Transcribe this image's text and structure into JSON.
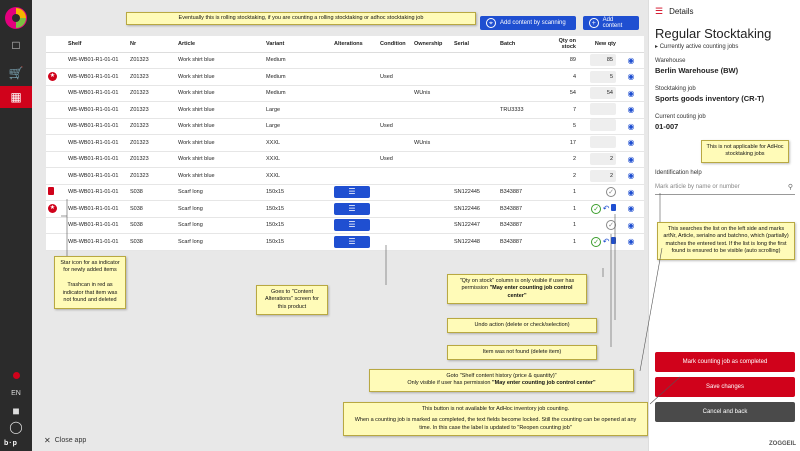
{
  "nav": {
    "language": "EN"
  },
  "toolbar": {
    "add_scan_label": "Add content by scanning",
    "add_content_label": "Add content"
  },
  "table": {
    "headers": [
      "",
      "Shelf",
      "Nr",
      "Article",
      "Variant",
      "Alterations",
      "Condition",
      "Ownership",
      "Serial",
      "Batch",
      "Qty on stock",
      "New qty",
      ""
    ],
    "rows": [
      {
        "flag": "",
        "shelf": "WB-WB01-R1-01-01",
        "nr": "Z01323",
        "article": "Work shirt blue",
        "variant": "Medium",
        "alterations": false,
        "condition": "",
        "ownership": "",
        "serial": "",
        "batch": "",
        "qty": "89",
        "new_qty": "85",
        "status": ""
      },
      {
        "flag": "star",
        "shelf": "WB-WB01-R1-01-01",
        "nr": "Z01323",
        "article": "Work shirt blue",
        "variant": "Medium",
        "alterations": false,
        "condition": "Used",
        "ownership": "",
        "serial": "",
        "batch": "",
        "qty": "4",
        "new_qty": "5",
        "status": ""
      },
      {
        "flag": "",
        "shelf": "WB-WB01-R1-01-01",
        "nr": "Z01323",
        "article": "Work shirt blue",
        "variant": "Medium",
        "alterations": false,
        "condition": "",
        "ownership": "WUnis",
        "serial": "",
        "batch": "",
        "qty": "54",
        "new_qty": "54",
        "status": ""
      },
      {
        "flag": "",
        "shelf": "WB-WB01-R1-01-01",
        "nr": "Z01323",
        "article": "Work shirt blue",
        "variant": "Large",
        "alterations": false,
        "condition": "",
        "ownership": "",
        "serial": "",
        "batch": "TRU3333",
        "qty": "7",
        "new_qty": "",
        "status": ""
      },
      {
        "flag": "",
        "shelf": "WB-WB01-R1-01-01",
        "nr": "Z01323",
        "article": "Work shirt blue",
        "variant": "Large",
        "alterations": false,
        "condition": "Used",
        "ownership": "",
        "serial": "",
        "batch": "",
        "qty": "5",
        "new_qty": "",
        "status": ""
      },
      {
        "flag": "",
        "shelf": "WB-WB01-R1-01-01",
        "nr": "Z01323",
        "article": "Work shirt blue",
        "variant": "XXXL",
        "alterations": false,
        "condition": "",
        "ownership": "WUnis",
        "serial": "",
        "batch": "",
        "qty": "17",
        "new_qty": "",
        "status": ""
      },
      {
        "flag": "",
        "shelf": "WB-WB01-R1-01-01",
        "nr": "Z01323",
        "article": "Work shirt blue",
        "variant": "XXXL",
        "alterations": false,
        "condition": "Used",
        "ownership": "",
        "serial": "",
        "batch": "",
        "qty": "2",
        "new_qty": "2",
        "status": ""
      },
      {
        "flag": "",
        "shelf": "WB-WB01-R1-01-01",
        "nr": "Z01323",
        "article": "Work shirt blue",
        "variant": "XXXL",
        "alterations": false,
        "condition": "",
        "ownership": "",
        "serial": "",
        "batch": "",
        "qty": "2",
        "new_qty": "2",
        "status": ""
      },
      {
        "flag": "trash",
        "shelf": "WB-WB01-R1-01-01",
        "nr": "S038",
        "article": "Scarf long",
        "variant": "150x15",
        "alterations": true,
        "condition": "",
        "ownership": "",
        "serial": "SN122445",
        "batch": "B343887",
        "qty": "1",
        "new_qty": "",
        "status": "check-grey"
      },
      {
        "flag": "star",
        "shelf": "WB-WB01-R1-01-01",
        "nr": "S038",
        "article": "Scarf long",
        "variant": "150x15",
        "alterations": true,
        "condition": "",
        "ownership": "",
        "serial": "SN122446",
        "batch": "B343887",
        "qty": "1",
        "new_qty": "",
        "status": "check-green"
      },
      {
        "flag": "",
        "shelf": "WB-WB01-R1-01-01",
        "nr": "S038",
        "article": "Scarf long",
        "variant": "150x15",
        "alterations": true,
        "condition": "",
        "ownership": "",
        "serial": "SN122447",
        "batch": "B343887",
        "qty": "1",
        "new_qty": "",
        "status": "check-grey"
      },
      {
        "flag": "",
        "shelf": "WB-WB01-R1-01-01",
        "nr": "S038",
        "article": "Scarf long",
        "variant": "150x15",
        "alterations": true,
        "condition": "",
        "ownership": "",
        "serial": "SN122448",
        "batch": "B343887",
        "qty": "1",
        "new_qty": "",
        "status": "check-green"
      }
    ]
  },
  "notes": {
    "top": "Eventually this is rolling stocktaking, if you are counting a rolling stocktaking or adhoc stocktaking job",
    "star": "Star icon for as indicator for newly added items\n\nTrashcan in red as indicator that item was not found and deleted",
    "alterations": "Goes to \"Content Alterations\" screen for this product",
    "qty_on_stock_pre": "\"Qty on stock\" column is only visible if user has permission ",
    "qty_on_stock_bold": "\"May enter counting job control center\"",
    "undo": "Undo action (delete or check/selection)",
    "not_found": "Item was not found (delete item)",
    "history_line1": "Goto \"Shelf content history (price & quantity)\"",
    "history_line2_pre": "Only visible if user has permission ",
    "history_line2_bold": "\"May enter counting job control center\"",
    "adhoc_line1": "This button is not available for AdHoc inventory job counting.",
    "adhoc_line2": "When a counting job is marked as completed, the text fields become locked. Still the counting can be opened at any time. In this case the label is updated to \"Reopen counting job\"",
    "not_applicable": "This is not applicable for AdHoc stocktaking jobs",
    "search_help": "This searches the list on the left side and marks artNr, Article, serialno and batchno, which (partially) matches the entered text. If the list is long the first found is ensured to be visible (auto scrolling)"
  },
  "close_app": "Close app",
  "details": {
    "header": "Details",
    "title": "Regular Stocktaking",
    "subtitle": "Currently active counting jobs",
    "warehouse_label": "Warehouse",
    "warehouse_value": "Berlin Warehouse (BW)",
    "job_label": "Stocktaking job",
    "job_value": "Sports goods inventory (CR-T)",
    "period_label": "Current couting job",
    "period_value": "01-007",
    "id_help_label": "Identification help",
    "search_placeholder": "Mark article by name or number",
    "complete_label": "Mark counting job as completed",
    "save_label": "Save changes",
    "cancel_label": "Cancel and back",
    "brand": "ZOGGEIL"
  },
  "colors": {
    "accent_red": "#d0021b",
    "accent_blue": "#1f4fd1",
    "note_yellow": "#fffbb8"
  }
}
